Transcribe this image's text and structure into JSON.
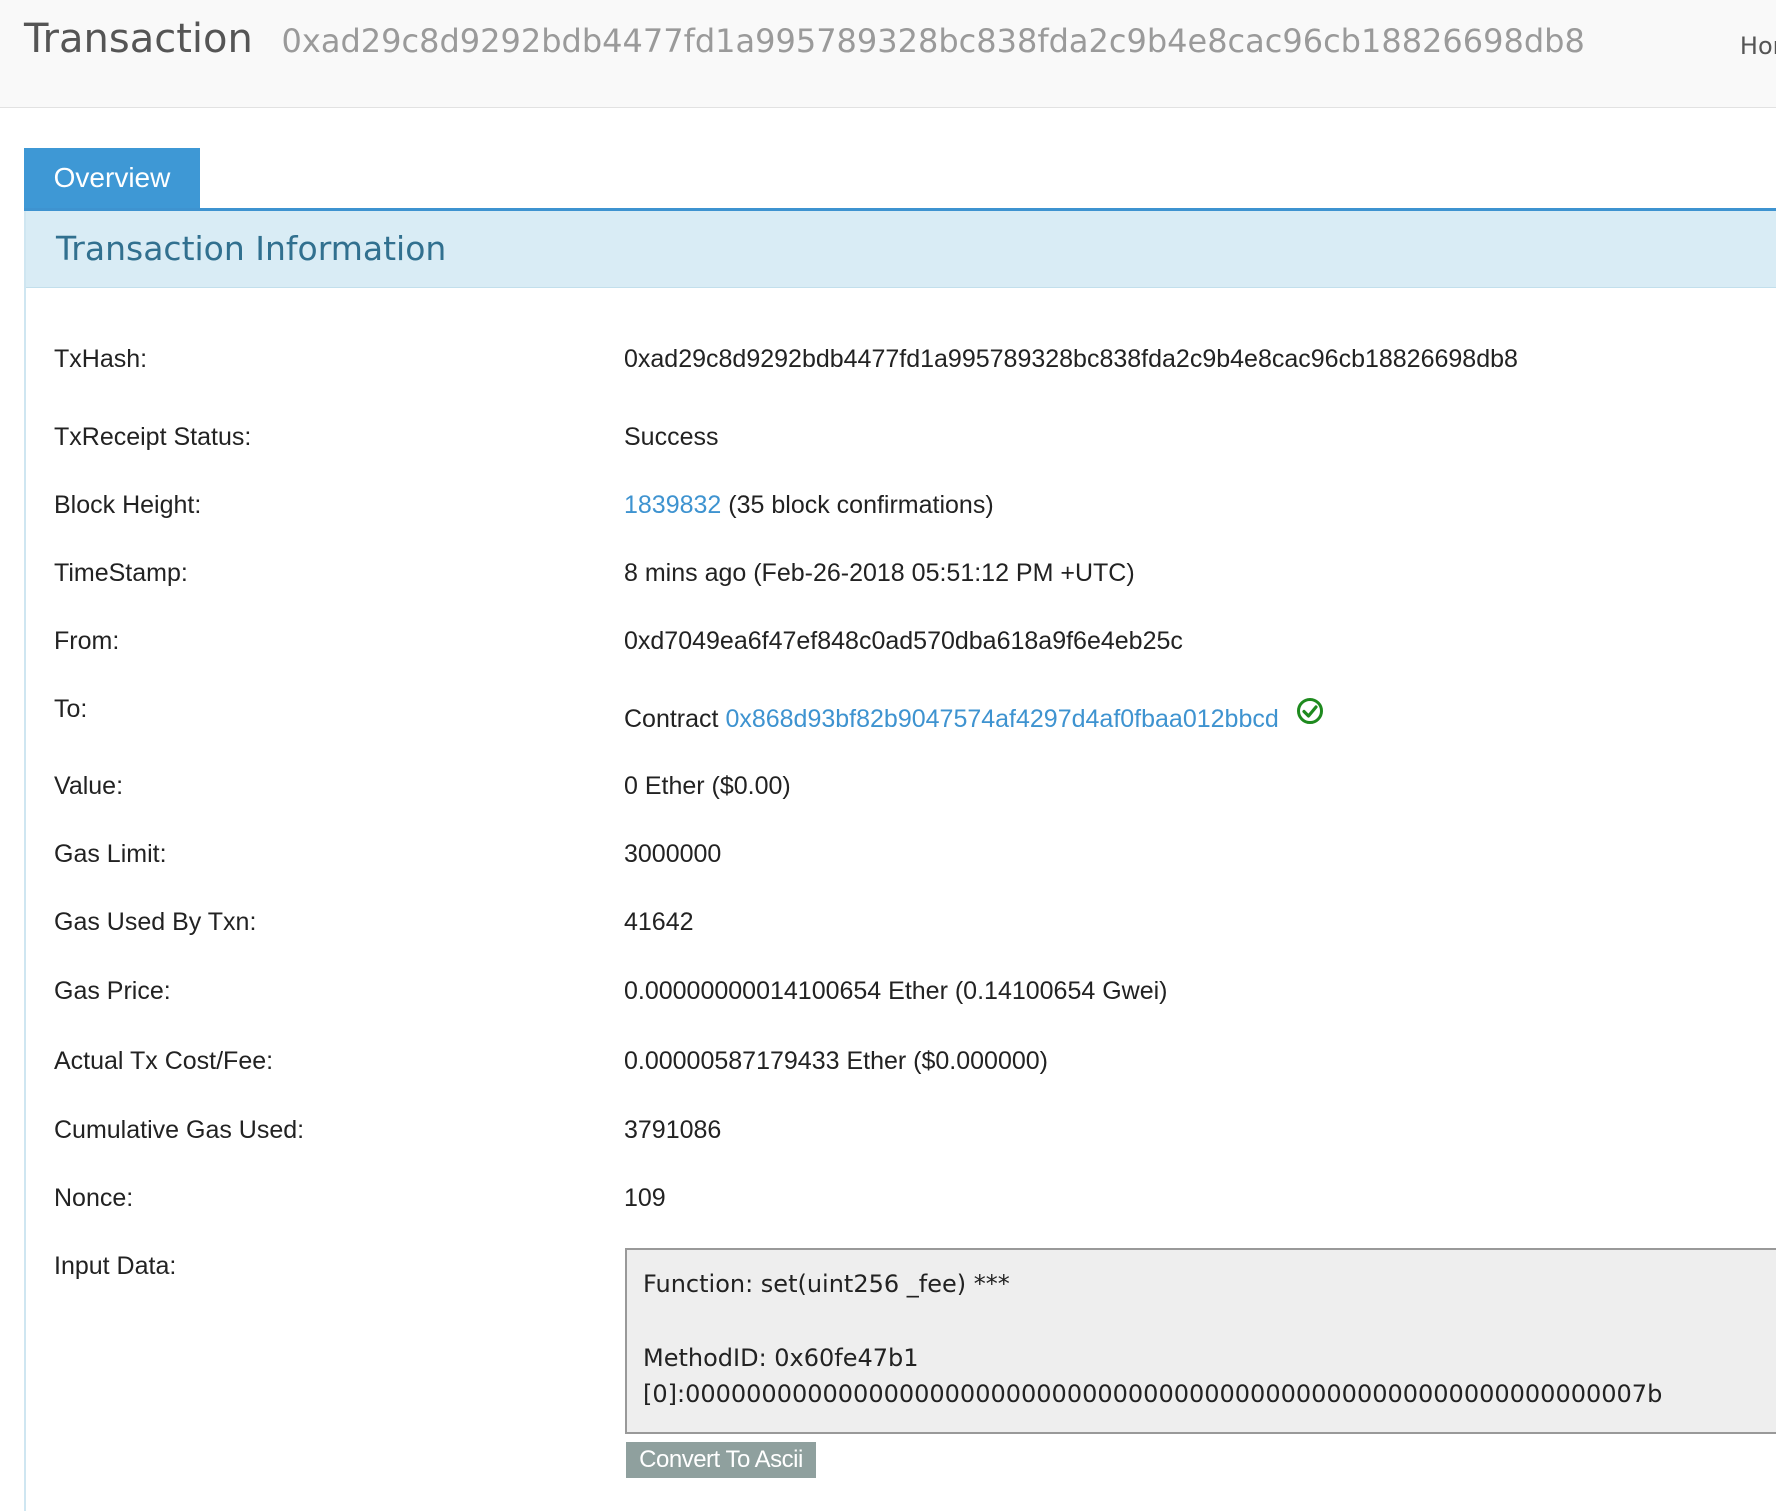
{
  "header": {
    "title": "Transaction",
    "tx_hash": "0xad29c8d9292bdb4477fd1a995789328bc838fda2c9b4e8cac96cb18826698db8",
    "nav_home": "Hom"
  },
  "tabs": [
    {
      "label": "Overview",
      "active": true
    }
  ],
  "panel": {
    "title": "Transaction Information"
  },
  "fields": {
    "txhash": {
      "label": "TxHash:",
      "value": "0xad29c8d9292bdb4477fd1a995789328bc838fda2c9b4e8cac96cb18826698db8"
    },
    "status": {
      "label": "TxReceipt Status:",
      "value": "Success"
    },
    "block_height": {
      "label": "Block Height:",
      "block": "1839832",
      "confirmations": "(35 block confirmations)"
    },
    "timestamp": {
      "label": "TimeStamp:",
      "value": "8 mins ago (Feb-26-2018 05:51:12 PM +UTC)"
    },
    "from": {
      "label": "From:",
      "value": "0xd7049ea6f47ef848c0ad570dba618a9f6e4eb25c"
    },
    "to": {
      "label": "To:",
      "prefix": "Contract",
      "value": "0x868d93bf82b9047574af4297d4af0fbaa012bbcd"
    },
    "value": {
      "label": "Value:",
      "value": "0 Ether ($0.00)"
    },
    "gas_limit": {
      "label": "Gas Limit:",
      "value": "3000000"
    },
    "gas_used": {
      "label": "Gas Used By Txn:",
      "value": "41642"
    },
    "gas_price": {
      "label": "Gas Price:",
      "value": "0.00000000014100654 Ether (0.14100654 Gwei)"
    },
    "fee": {
      "label": "Actual Tx Cost/Fee:",
      "value": "0.00000587179433 Ether ($0.000000)"
    },
    "cumulative_gas": {
      "label": "Cumulative Gas Used:",
      "value": "3791086"
    },
    "nonce": {
      "label": "Nonce:",
      "value": "109"
    },
    "input_data": {
      "label": "Input Data:",
      "function": "Function: set(uint256 _fee) ***",
      "method_id": "MethodID: 0x60fe47b1",
      "param0": "[0]:000000000000000000000000000000000000000000000000000000000000007b"
    }
  },
  "buttons": {
    "convert_ascii": "Convert To Ascii"
  },
  "colors": {
    "accent": "#3e98d5",
    "link": "#3e93d0",
    "success": "#1e8a1e",
    "panel_header_bg": "#d9ecf5",
    "panel_title": "#31708f",
    "button_gray": "#8fa09e"
  }
}
